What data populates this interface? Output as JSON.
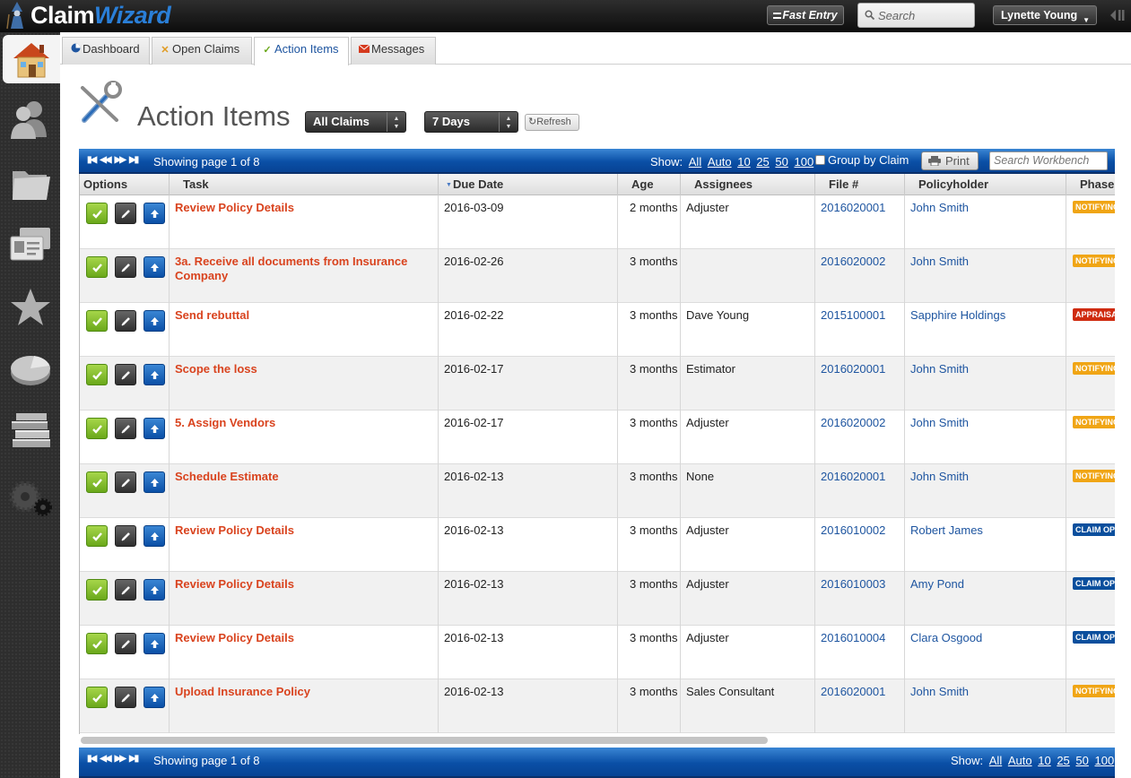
{
  "app": {
    "brand_part1": "Claim",
    "brand_part2": "Wizard"
  },
  "topbar": {
    "fast_entry_label": "Fast Entry",
    "search_placeholder": "Search",
    "user_name": "Lynette Young"
  },
  "sidebar": {
    "items": [
      "home-icon",
      "contacts-icon",
      "folder-icon",
      "id-cards-icon",
      "star-icon",
      "pie-chart-icon",
      "books-icon",
      "settings-gears-icon"
    ]
  },
  "tabs": [
    {
      "label": "Dashboard",
      "icon": "pie-icon"
    },
    {
      "label": "Open Claims",
      "icon": "tools-icon"
    },
    {
      "label": "Action Items",
      "icon": "checkmark-icon",
      "active": true
    },
    {
      "label": "Messages",
      "icon": "envelope-icon"
    }
  ],
  "page": {
    "title": "Action Items",
    "filter_claims": "All Claims",
    "filter_days": "7 Days",
    "refresh_label": "Refresh"
  },
  "pager": {
    "showing": "Showing page 1 of 8",
    "show_label": "Show:",
    "show_options": [
      "All",
      "Auto",
      "10",
      "25",
      "50",
      "100"
    ],
    "group_by_label": "Group by Claim",
    "print_label": "Print",
    "search_placeholder": "Search Workbench"
  },
  "table": {
    "columns": [
      "Options",
      "Task",
      "Due Date",
      "Age",
      "Assignees",
      "File #",
      "Policyholder",
      "Phase"
    ],
    "rows": [
      {
        "task": "Review Policy Details",
        "due": "2016-03-09",
        "age": "2 months",
        "assignee": "Adjuster",
        "file": "2016020001",
        "holder": "John Smith",
        "phase": "NOTIFYING",
        "phase_type": "notifying"
      },
      {
        "task": "3a. Receive all documents from Insurance Company",
        "due": "2016-02-26",
        "age": "3 months",
        "assignee": "",
        "file": "2016020002",
        "holder": "John Smith",
        "phase": "NOTIFYING",
        "phase_type": "notifying"
      },
      {
        "task": "Send rebuttal",
        "due": "2016-02-22",
        "age": "3 months",
        "assignee": "Dave Young",
        "file": "2015100001",
        "holder": "Sapphire Holdings",
        "phase": "APPRAISAL",
        "phase_type": "appraisal"
      },
      {
        "task": "Scope the loss",
        "due": "2016-02-17",
        "age": "3 months",
        "assignee": "Estimator",
        "file": "2016020001",
        "holder": "John Smith",
        "phase": "NOTIFYING",
        "phase_type": "notifying"
      },
      {
        "task": "5. Assign Vendors",
        "due": "2016-02-17",
        "age": "3 months",
        "assignee": "Adjuster",
        "file": "2016020002",
        "holder": "John Smith",
        "phase": "NOTIFYING",
        "phase_type": "notifying"
      },
      {
        "task": "Schedule Estimate",
        "due": "2016-02-13",
        "age": "3 months",
        "assignee": "None",
        "file": "2016020001",
        "holder": "John Smith",
        "phase": "NOTIFYING",
        "phase_type": "notifying"
      },
      {
        "task": "Review Policy Details",
        "due": "2016-02-13",
        "age": "3 months",
        "assignee": "Adjuster",
        "file": "2016010002",
        "holder": "Robert James",
        "phase": "CLAIM OPEN",
        "phase_type": "claimopen"
      },
      {
        "task": "Review Policy Details",
        "due": "2016-02-13",
        "age": "3 months",
        "assignee": "Adjuster",
        "file": "2016010003",
        "holder": "Amy Pond",
        "phase": "CLAIM OPEN",
        "phase_type": "claimopen"
      },
      {
        "task": "Review Policy Details",
        "due": "2016-02-13",
        "age": "3 months",
        "assignee": "Adjuster",
        "file": "2016010004",
        "holder": "Clara Osgood",
        "phase": "CLAIM OPEN",
        "phase_type": "claimopen"
      },
      {
        "task": "Upload Insurance Policy",
        "due": "2016-02-13",
        "age": "3 months",
        "assignee": "Sales Consultant",
        "file": "2016020001",
        "holder": "John Smith",
        "phase": "NOTIFYING",
        "phase_type": "notifying"
      }
    ]
  }
}
